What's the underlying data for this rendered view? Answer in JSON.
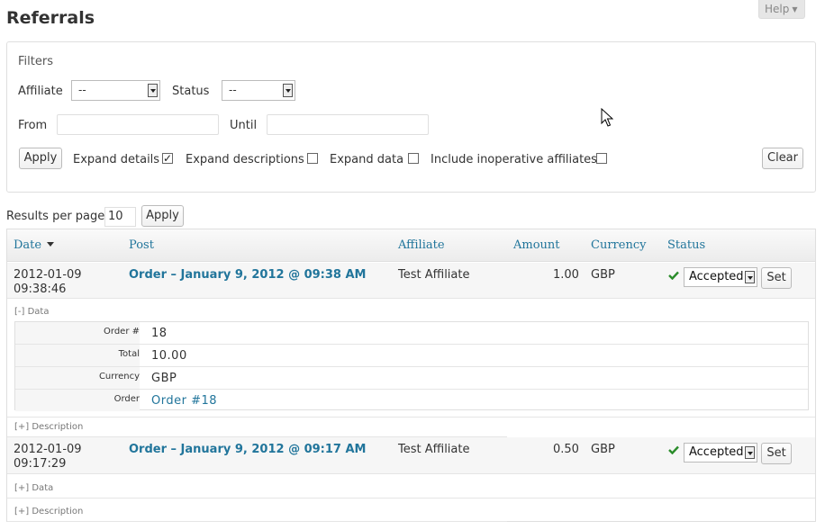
{
  "page": {
    "title": "Referrals",
    "help_label": "Help"
  },
  "filters": {
    "title": "Filters",
    "affiliate_label": "Affiliate",
    "affiliate_value": "--",
    "status_label": "Status",
    "status_value": "--",
    "from_label": "From",
    "from_value": "",
    "until_label": "Until",
    "until_value": "",
    "apply_label": "Apply",
    "expand_details_label": "Expand details",
    "expand_details_checked": true,
    "expand_descriptions_label": "Expand descriptions",
    "expand_descriptions_checked": false,
    "expand_data_label": "Expand data",
    "expand_data_checked": false,
    "include_inoperative_label": "Include inoperative affiliates",
    "include_inoperative_checked": false,
    "clear_label": "Clear"
  },
  "pagination": {
    "results_per_page_label": "Results per page",
    "results_per_page_value": "10",
    "apply_label": "Apply"
  },
  "table": {
    "columns": [
      "Date",
      "Post",
      "Affiliate",
      "Amount",
      "Currency",
      "Status"
    ],
    "rows": [
      {
        "date": "2012-01-09",
        "time": "09:38:46",
        "post": "Order – January 9, 2012 @ 09:38 AM",
        "affiliate": "Test Affiliate",
        "amount": "1.00",
        "currency": "GBP",
        "status": "Accepted",
        "set_label": "Set",
        "data_toggle": "[-] Data",
        "description_toggle": "[+] Description",
        "data": [
          {
            "key": "Order #",
            "value": "18"
          },
          {
            "key": "Total",
            "value": "10.00"
          },
          {
            "key": "Currency",
            "value": "GBP"
          },
          {
            "key": "Order",
            "value": "Order #18"
          }
        ]
      },
      {
        "date": "2012-01-09",
        "time": "09:17:29",
        "post": "Order – January 9, 2012 @ 09:17 AM",
        "affiliate": "Test Affiliate",
        "amount": "0.50",
        "currency": "GBP",
        "status": "Accepted",
        "set_label": "Set",
        "data_toggle": "[+] Data",
        "description_toggle": "[+] Description"
      }
    ]
  },
  "colors": {
    "link": "#21759b",
    "accepted_check": "#2a8c2a"
  }
}
